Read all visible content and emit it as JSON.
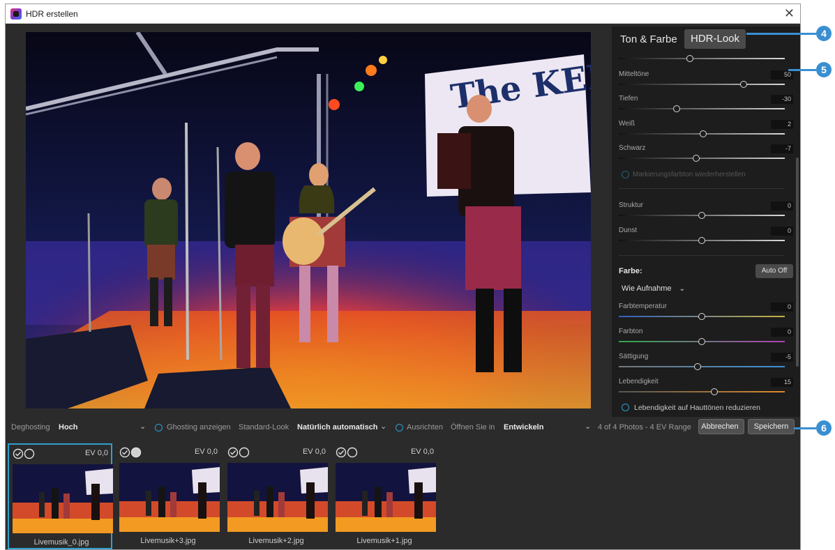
{
  "window": {
    "title": "HDR erstellen",
    "close_glyph": "✕"
  },
  "panel": {
    "tabs": [
      {
        "label": "Ton & Farbe"
      },
      {
        "label": "HDR-Look"
      }
    ],
    "sliders": [
      {
        "label": "Mitteltöne",
        "value": "50",
        "level": 0.75
      },
      {
        "label": "Tiefen",
        "value": "-30",
        "level": 0.35
      },
      {
        "label": "Weiß",
        "value": "2",
        "level": 0.51
      },
      {
        "label": "Schwarz",
        "value": "-7",
        "level": 0.465
      },
      {
        "label": "Struktur",
        "value": "0",
        "level": 0.5
      },
      {
        "label": "Dunst",
        "value": "0",
        "level": 0.5
      },
      {
        "label": "Farbtemperatur",
        "value": "0",
        "level": 0.5
      },
      {
        "label": "Farbton",
        "value": "0",
        "level": 0.5
      },
      {
        "label": "Sättigung",
        "value": "-5",
        "level": 0.475
      },
      {
        "label": "Lebendigkeit",
        "value": "15",
        "level": 0.575
      }
    ],
    "top_slider_level": 0.43,
    "restore_option": "Markierungsfarbton wiederherstellen",
    "color_heading": "Farbe:",
    "auto_off": "Auto Off",
    "wb_select": "Wie Aufnahme",
    "skin_option": "Lebendigkeit auf Hauttönen reduzieren"
  },
  "toolbar": {
    "deghosting_label": "Deghosting",
    "deghosting_value": "Hoch",
    "ghosting_show": "Ghosting anzeigen",
    "look_label": "Standard-Look",
    "look_value": "Natürlich automatisch",
    "align_label": "Ausrichten",
    "open_in_label": "Öffnen Sie in",
    "open_in_value": "Entwickeln",
    "photo_info": "4 of 4 Photos - 4 EV Range",
    "cancel_button": "Abbrechen",
    "save_button": "Speichern"
  },
  "filmstrip": [
    {
      "name": "Livemusik_0.jpg",
      "ev": "EV 0,0",
      "selected": true
    },
    {
      "name": "Livemusik+3.jpg",
      "ev": "EV 0,0",
      "selected": false
    },
    {
      "name": "Livemusik+2.jpg",
      "ev": "EV 0,0",
      "selected": false
    },
    {
      "name": "Livemusik+1.jpg",
      "ev": "EV 0,0",
      "selected": false
    }
  ],
  "callouts": [
    "4",
    "5",
    "6"
  ],
  "photo_banner_text": "The KELTICS",
  "colors": {
    "accent": "#2f9fd0",
    "callout": "#3a8fd0",
    "panel_bg": "#1d1d1d",
    "window_bg": "#2b2b2b"
  }
}
